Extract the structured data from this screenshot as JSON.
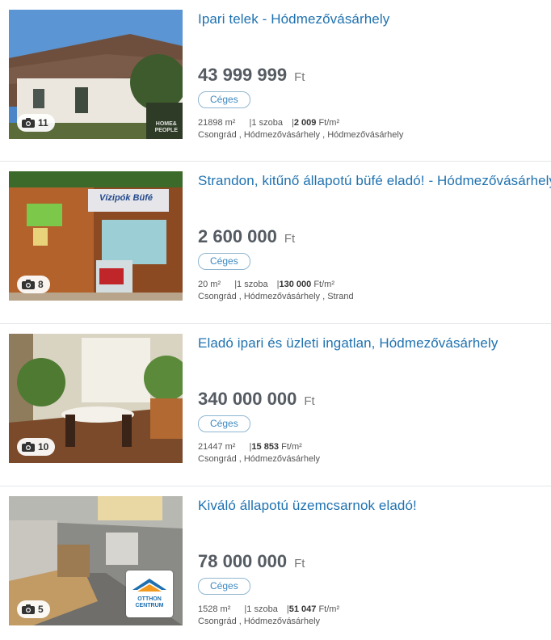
{
  "listings": [
    {
      "title": "Ipari telek - Hódmezővásárhely",
      "price": "43 999 999",
      "currency": "Ft",
      "badge": "Céges",
      "photo_count": "11",
      "area": "21898 m²",
      "rooms": "1 szoba",
      "price_per_m2": "2 009",
      "price_per_m2_unit": "Ft/m²",
      "location": "Csongrád , Hódmezővásárhely , Hódmezővásárhely",
      "watermark": [
        "HOME&",
        "PEOPLE"
      ]
    },
    {
      "title": "Strandon, kitűnő állapotú büfé eladó! - Hódmezővásárhely",
      "price": "2 600 000",
      "currency": "Ft",
      "badge": "Céges",
      "photo_count": "8",
      "area": "20 m²",
      "rooms": "1 szoba",
      "price_per_m2": "130 000",
      "price_per_m2_unit": "Ft/m²",
      "location": "Csongrád , Hódmezővásárhely , Strand",
      "sign_text": "Vízipók Büfé"
    },
    {
      "title": "Eladó ipari és üzleti ingatlan, Hódmezővásárhely",
      "price": "340 000 000",
      "currency": "Ft",
      "badge": "Céges",
      "photo_count": "10",
      "area": "21447 m²",
      "price_per_m2": "15 853",
      "price_per_m2_unit": "Ft/m²",
      "location": "Csongrád , Hódmezővásárhely"
    },
    {
      "title": "Kiváló állapotú üzemcsarnok eladó!",
      "price": "78 000 000",
      "currency": "Ft",
      "badge": "Céges",
      "photo_count": "5",
      "area": "1528 m²",
      "rooms": "1 szoba",
      "price_per_m2": "51 047",
      "price_per_m2_unit": "Ft/m²",
      "location": "Csongrád , Hódmezővásárhely",
      "agency_logo": [
        "OTTHON",
        "CENTRUM"
      ]
    }
  ],
  "icons": {
    "photo_badge": "camera-icon"
  },
  "colors": {
    "title": "#1f72b0",
    "price": "#555b62",
    "badge_border": "#8fb6d1"
  }
}
